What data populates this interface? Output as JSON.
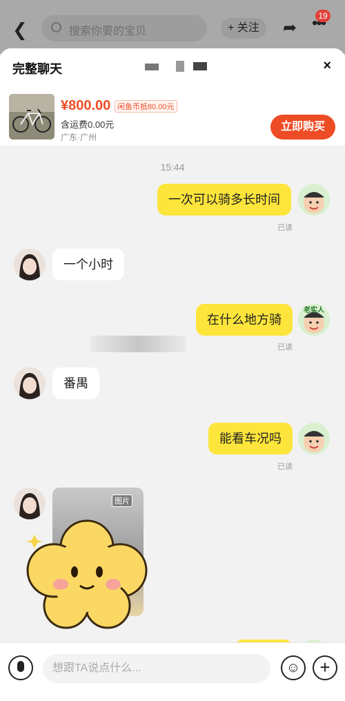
{
  "topbar": {
    "back_icon": "chevron-left-icon",
    "search_placeholder": "搜索你要的宝贝",
    "follow_label": "+ 关注",
    "share_icon": "share-icon",
    "more_icon": "more-icon",
    "badge_count": "19"
  },
  "sheet": {
    "title": "完整聊天",
    "close_label": "×"
  },
  "product": {
    "price": "¥800.00",
    "coin_text": "闲鱼币抵80.00元",
    "shipping": "含运费0.00元",
    "location": "广东·广州",
    "buy_label": "立即购买",
    "accent": "#ee4c25"
  },
  "chat": {
    "timestamp": "15:44",
    "self_avatar_tag": "老实人",
    "image_tag": "图片",
    "read_label": "已读",
    "messages": [
      {
        "from": "self",
        "text": "一次可以骑多长时间",
        "read": "已读"
      },
      {
        "from": "other",
        "text": "一个小时"
      },
      {
        "from": "self",
        "text": "在什么地方骑",
        "read": "已读"
      },
      {
        "from": "other",
        "text": "番禺"
      },
      {
        "from": "self",
        "text": "能看车况吗",
        "read": "已读"
      }
    ],
    "bubble_color": "#fde53b"
  },
  "inputbar": {
    "placeholder": "想跟TA说点什么...",
    "mic_icon": "microphone-icon",
    "emoji_icon": "emoji-icon",
    "plus_icon": "plus-icon"
  }
}
